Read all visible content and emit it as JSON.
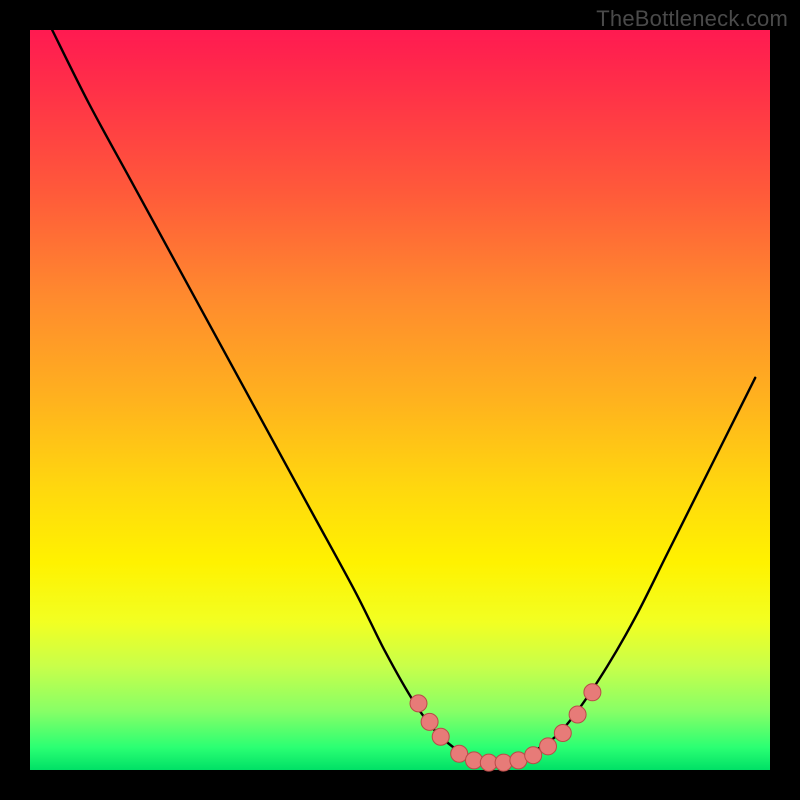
{
  "watermark": "TheBottleneck.com",
  "colors": {
    "background": "#000000",
    "gradient_top": "#ff1a51",
    "gradient_mid1": "#ffb21e",
    "gradient_mid2": "#fff200",
    "gradient_bottom": "#00e066",
    "curve_stroke": "#000000",
    "marker_fill": "#e77b78",
    "marker_stroke": "#b94b48"
  },
  "chart_data": {
    "type": "line",
    "title": "",
    "xlabel": "",
    "ylabel": "",
    "xlim": [
      0,
      100
    ],
    "ylim": [
      0,
      100
    ],
    "grid": false,
    "legend": false,
    "series": [
      {
        "name": "bottleneck-curve",
        "x": [
          3,
          8,
          14,
          20,
          26,
          32,
          38,
          44,
          48,
          52,
          55,
          58,
          60,
          63,
          66,
          68,
          71,
          74,
          78,
          82,
          86,
          90,
          94,
          98
        ],
        "y": [
          100,
          90,
          79,
          68,
          57,
          46,
          35,
          24,
          16,
          9,
          5,
          2.5,
          1.5,
          1,
          1.5,
          2.5,
          4.5,
          8,
          14,
          21,
          29,
          37,
          45,
          53
        ]
      }
    ],
    "markers": [
      {
        "x": 52.5,
        "y": 9.0
      },
      {
        "x": 54.0,
        "y": 6.5
      },
      {
        "x": 55.5,
        "y": 4.5
      },
      {
        "x": 58.0,
        "y": 2.2
      },
      {
        "x": 60.0,
        "y": 1.3
      },
      {
        "x": 62.0,
        "y": 1.0
      },
      {
        "x": 64.0,
        "y": 1.0
      },
      {
        "x": 66.0,
        "y": 1.3
      },
      {
        "x": 68.0,
        "y": 2.0
      },
      {
        "x": 70.0,
        "y": 3.2
      },
      {
        "x": 72.0,
        "y": 5.0
      },
      {
        "x": 74.0,
        "y": 7.5
      },
      {
        "x": 76.0,
        "y": 10.5
      }
    ]
  }
}
